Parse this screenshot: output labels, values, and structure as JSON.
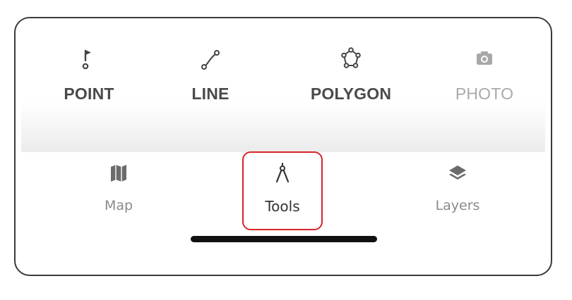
{
  "tools": {
    "point": {
      "label": "POINT",
      "icon": "point-flag-icon"
    },
    "line": {
      "label": "LINE",
      "icon": "line-icon"
    },
    "polygon": {
      "label": "POLYGON",
      "icon": "polygon-icon"
    },
    "photo": {
      "label": "PHOTO",
      "icon": "camera-icon",
      "disabled": true
    }
  },
  "nav": {
    "map": {
      "label": "Map",
      "icon": "map-icon"
    },
    "tools": {
      "label": "Tools",
      "icon": "compass-tool-icon",
      "active": true
    },
    "layers": {
      "label": "Layers",
      "icon": "layers-icon"
    }
  },
  "colors": {
    "highlight": "#d9232a",
    "text_active": "#333333",
    "text_inactive": "#8a8a8a",
    "disabled": "#aaaaaa"
  }
}
